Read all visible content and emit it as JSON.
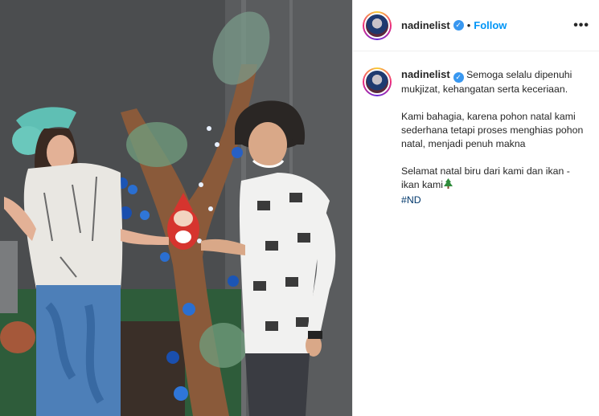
{
  "header": {
    "username": "nadinelist",
    "verified_icon": "verified-badge-icon",
    "separator": "•",
    "follow_label": "Follow",
    "more_label": "•••"
  },
  "caption": {
    "username": "nadinelist",
    "line1": "Semoga selalu dipenuhi mukjizat, kehangatan serta keceriaan.",
    "paragraph2": "Kami bahagia, karena pohon natal kami sederhana tetapi proses menghias pohon natal, menjadi penuh makna",
    "paragraph3": "Selamat natal biru dari kami dan ikan - ikan kami",
    "emoji": "christmas-tree-icon",
    "hashtag": "#ND"
  },
  "colors": {
    "follow_blue": "#0095f6",
    "verified_blue": "#3897f0",
    "hashtag_blue": "#00376b",
    "text": "#262626"
  }
}
